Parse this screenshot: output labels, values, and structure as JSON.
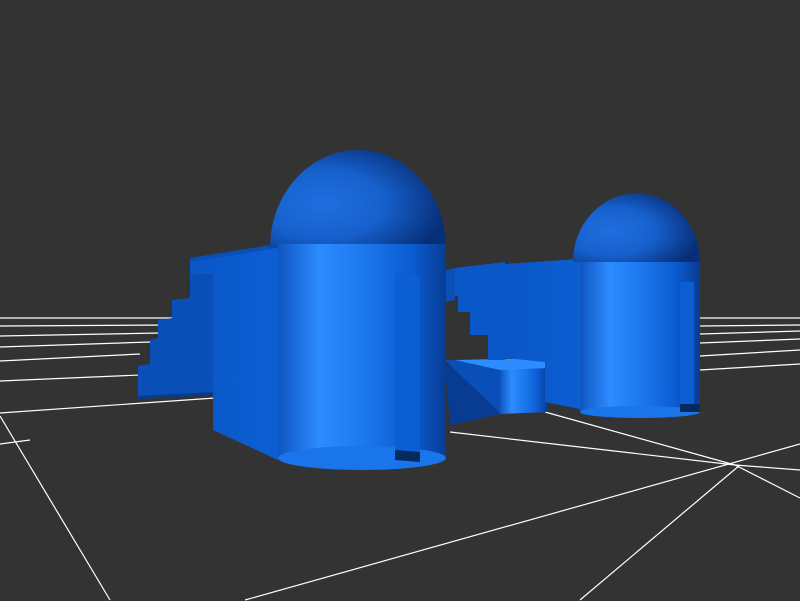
{
  "viewport": {
    "background_color": "#333333",
    "grid_color": "#ffffff",
    "model_color": "#1f6fe0",
    "model_highlight_color": "#2a8bff",
    "model_shadow_color": "#0a3f94"
  },
  "scene": {
    "objects": [
      "ground-grid",
      "left-tower-with-dome",
      "left-stepped-wall",
      "connector-bridge",
      "right-tower-with-dome",
      "right-stepped-wall"
    ]
  }
}
